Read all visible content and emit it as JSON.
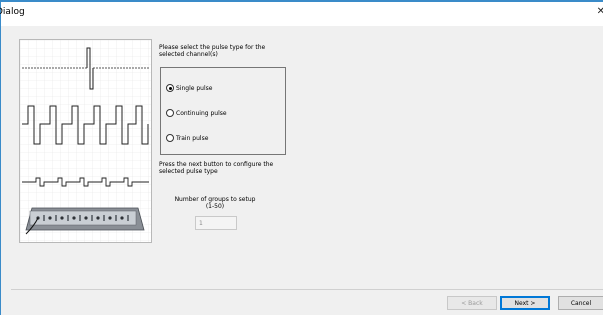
{
  "window": {
    "title": "Dialog",
    "close_icon": "close-icon"
  },
  "prompt": {
    "text": "Please select the pulse type for the selected channel(s)"
  },
  "pulse_options": [
    {
      "label": "Single pulse",
      "selected": true
    },
    {
      "label": "Continuing pulse",
      "selected": false
    },
    {
      "label": "Train pulse",
      "selected": false
    }
  ],
  "instructions": {
    "next_text": "Press the next button to configure the selected pulse type"
  },
  "groups": {
    "label": "Number of groups to setup (1-50)",
    "value": "1"
  },
  "buttons": {
    "back": "< Back",
    "next": "Next >",
    "cancel": "Cancel"
  },
  "colors": {
    "accent": "#0078d7",
    "window_border": "#3a8bc9"
  }
}
